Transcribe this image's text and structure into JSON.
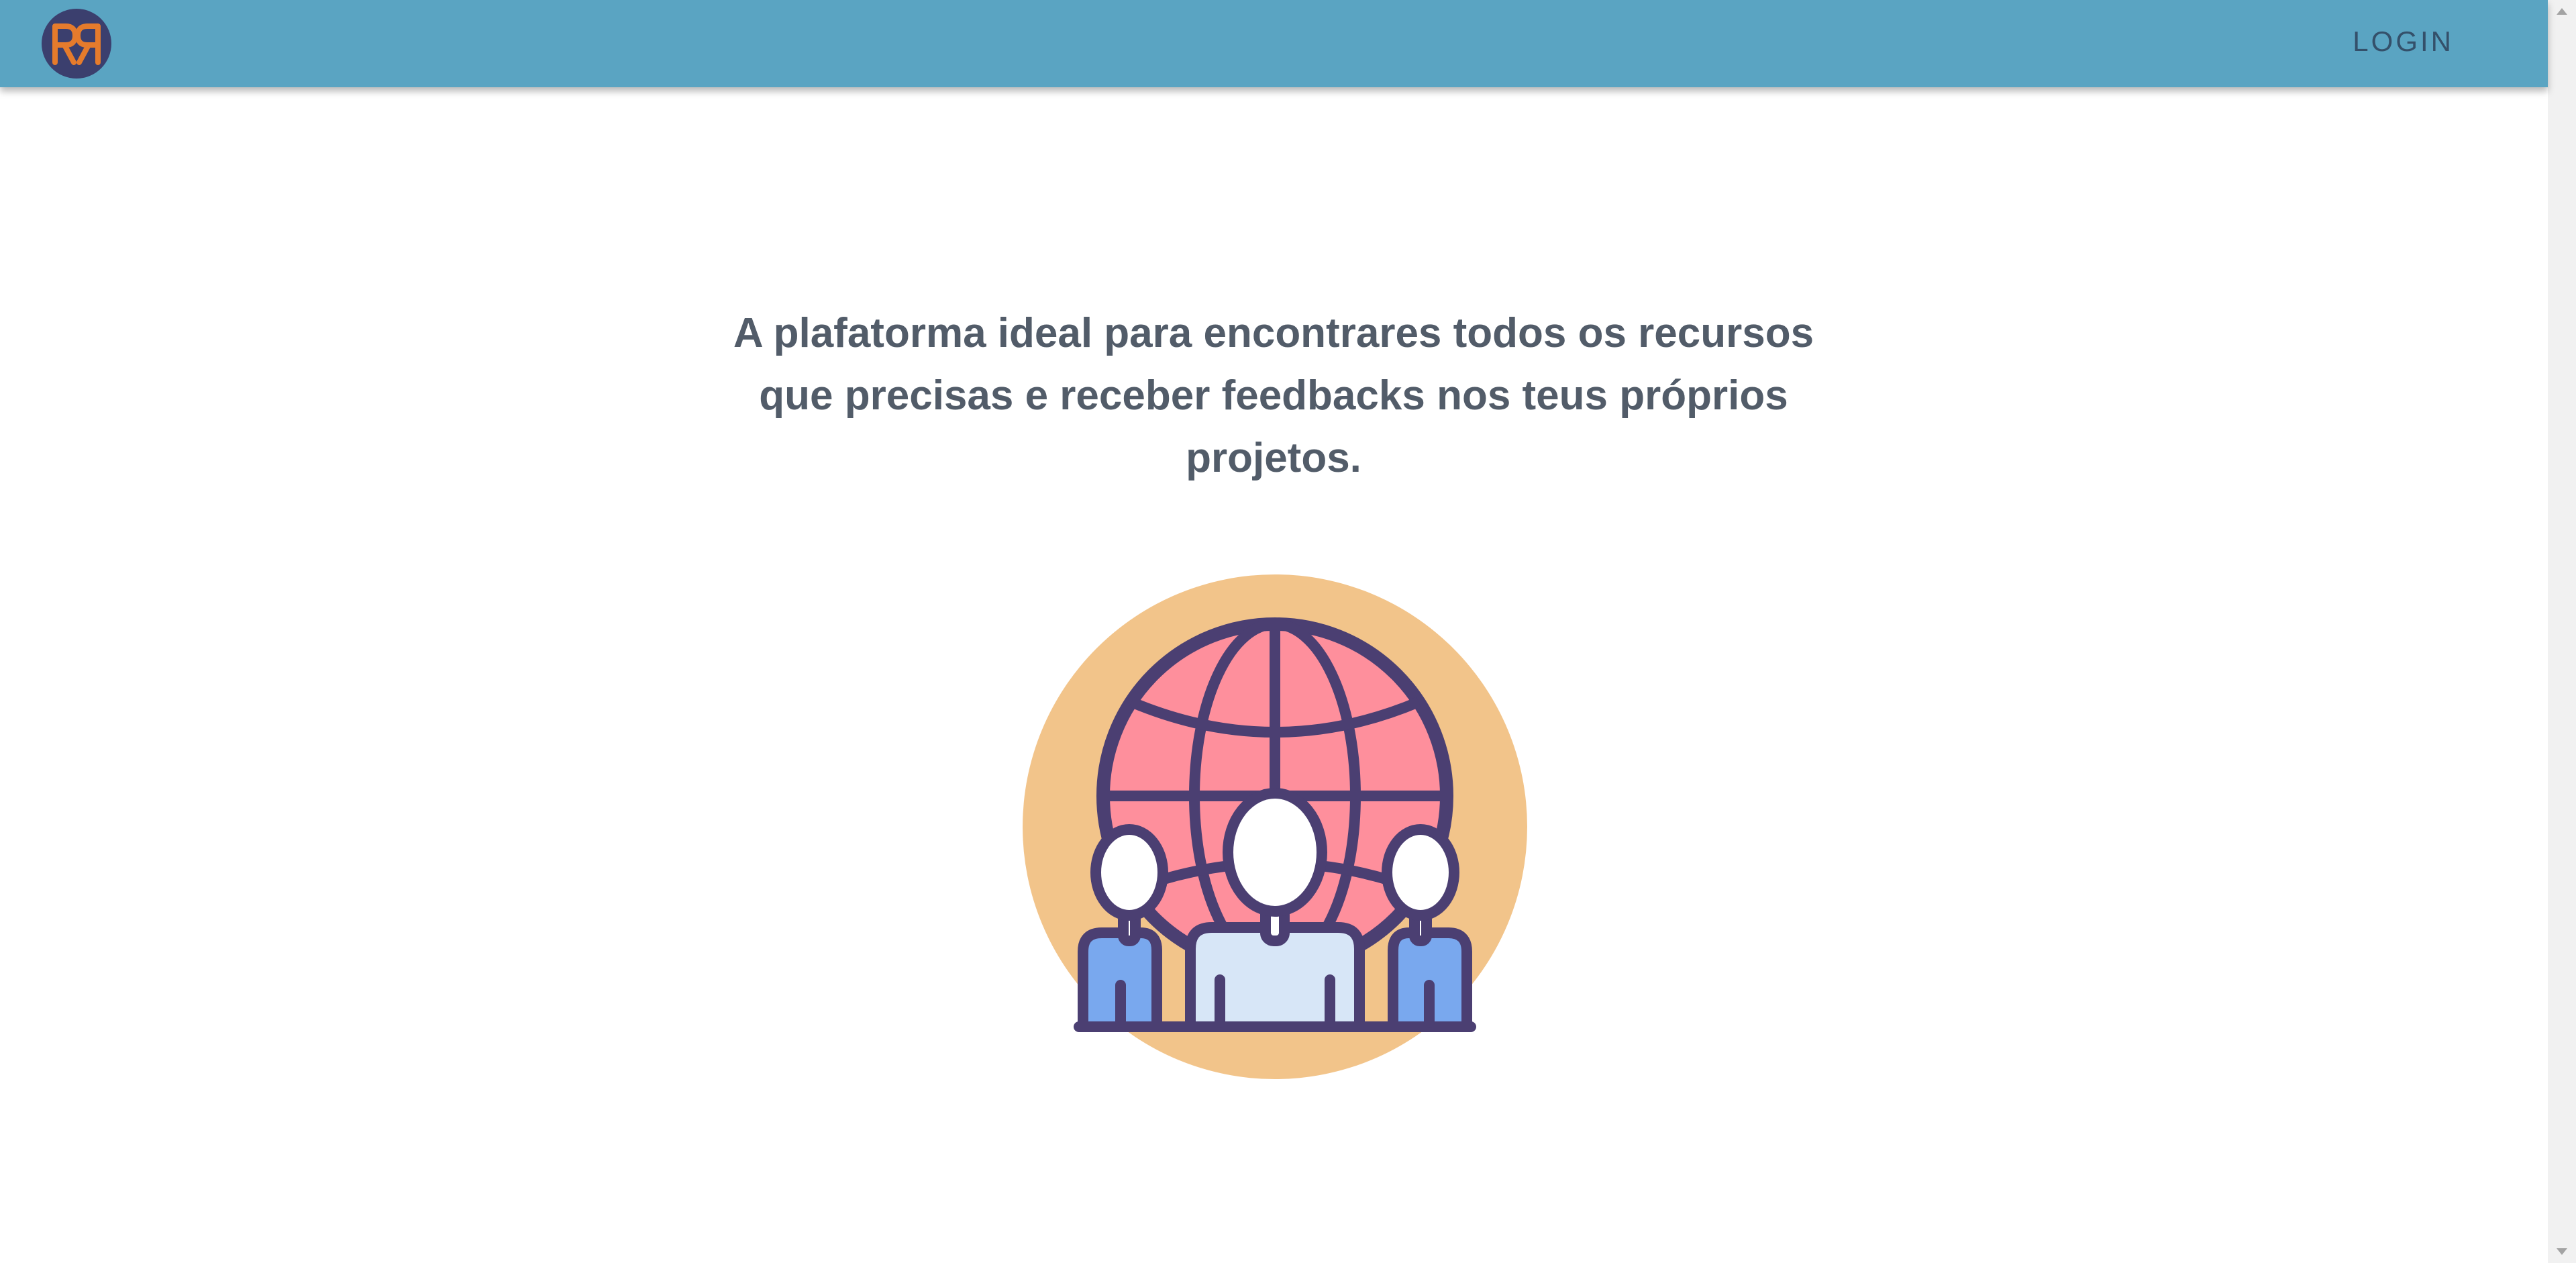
{
  "header": {
    "logo_text": "RR",
    "login_label": "LOGIN"
  },
  "hero": {
    "headline": "A plafatorma ideal para encontrares todos os recursos que precisas e receber feedbacks nos teus próprios projetos.",
    "illustration": "globe-with-people-icon"
  },
  "colors": {
    "navbar": "#5aa4c2",
    "logo_bg": "#3b3f6e",
    "logo_letters": "#e57b2c",
    "headline_text": "#525c69",
    "illustration_circle": "#f2c48a",
    "globe_fill": "#fe8f9c",
    "outline": "#4b3f72",
    "people_side": "#79a8ee",
    "people_center": "#d7e6f7"
  }
}
